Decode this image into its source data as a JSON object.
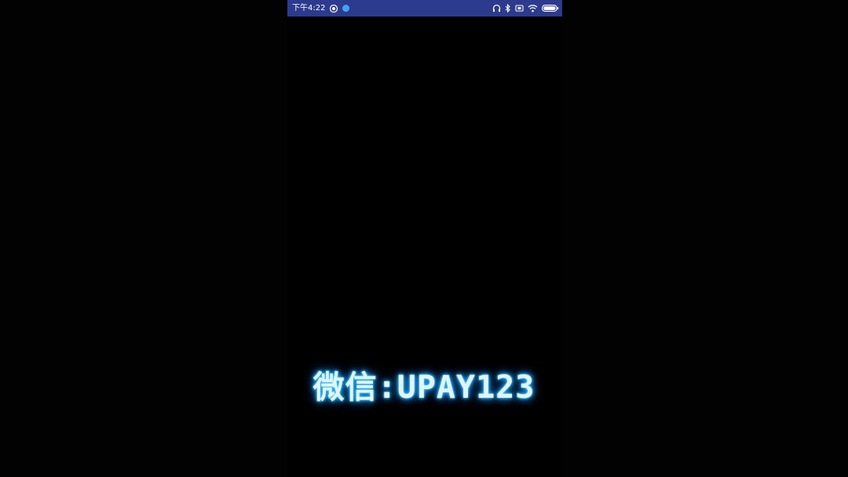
{
  "status_bar": {
    "time": "下午4:22",
    "colors": {
      "background": "#2d3b8f",
      "text": "#ffffff",
      "notification_dot": "#3fa4ff"
    },
    "left_icons": [
      "screen-record-icon",
      "app-notification-icon"
    ],
    "right_icons": [
      "headphones-icon",
      "bluetooth-icon",
      "sim-icon",
      "wifi-icon",
      "battery-icon"
    ]
  },
  "caption": {
    "text": "微信:UPAY123",
    "color": "#dff6ff",
    "glow_color": "#2fb8ff"
  },
  "background_color": "#000000"
}
